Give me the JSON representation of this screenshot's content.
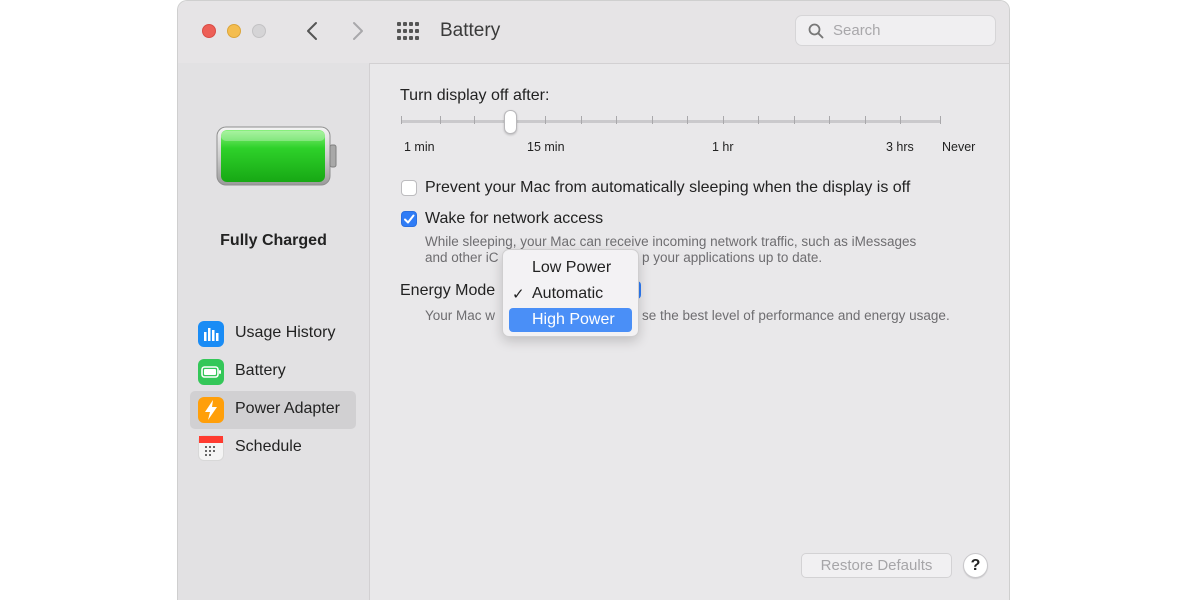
{
  "window": {
    "title": "Battery"
  },
  "search": {
    "placeholder": "Search"
  },
  "sidebar": {
    "status": "Fully Charged",
    "battery_level": 1.0,
    "items": [
      {
        "label": "Usage History",
        "icon": "bar-chart-icon",
        "color": "#1a8cf5"
      },
      {
        "label": "Battery",
        "icon": "battery-icon",
        "color": "#34c759"
      },
      {
        "label": "Power Adapter",
        "icon": "lightning-icon",
        "color": "#ff9f0a",
        "selected": true
      },
      {
        "label": "Schedule",
        "icon": "calendar-icon",
        "color": "#ff3b30"
      }
    ]
  },
  "display_sleep": {
    "label": "Turn display off after:",
    "ticks": [
      "1 min",
      "15 min",
      "1 hr",
      "3 hrs",
      "Never"
    ],
    "selected": "15 min"
  },
  "options": {
    "prevent_sleep": {
      "label": "Prevent your Mac from automatically sleeping when the display is off",
      "checked": false
    },
    "wake_network": {
      "label": "Wake for network access",
      "checked": true,
      "desc_line1_a": "While sleeping, your Mac can receive incoming network traffic, such as iMessages",
      "desc_line2_a": "and other iC",
      "desc_line2_b": "p your applications up to date."
    }
  },
  "energy_mode": {
    "label": "Energy Mode",
    "desc_a": "Your Mac w",
    "desc_b": "se the best level of performance and energy usage.",
    "menu": [
      "Low Power",
      "Automatic",
      "High Power"
    ],
    "checked": "Automatic",
    "highlighted": "High Power",
    "checkmark": "✓"
  },
  "footer": {
    "restore_label": "Restore Defaults",
    "help_label": "?"
  },
  "colors": {
    "accent": "#2f7cf6",
    "highlight": "#4a8ff7",
    "battery_green": "#2ed12a"
  }
}
